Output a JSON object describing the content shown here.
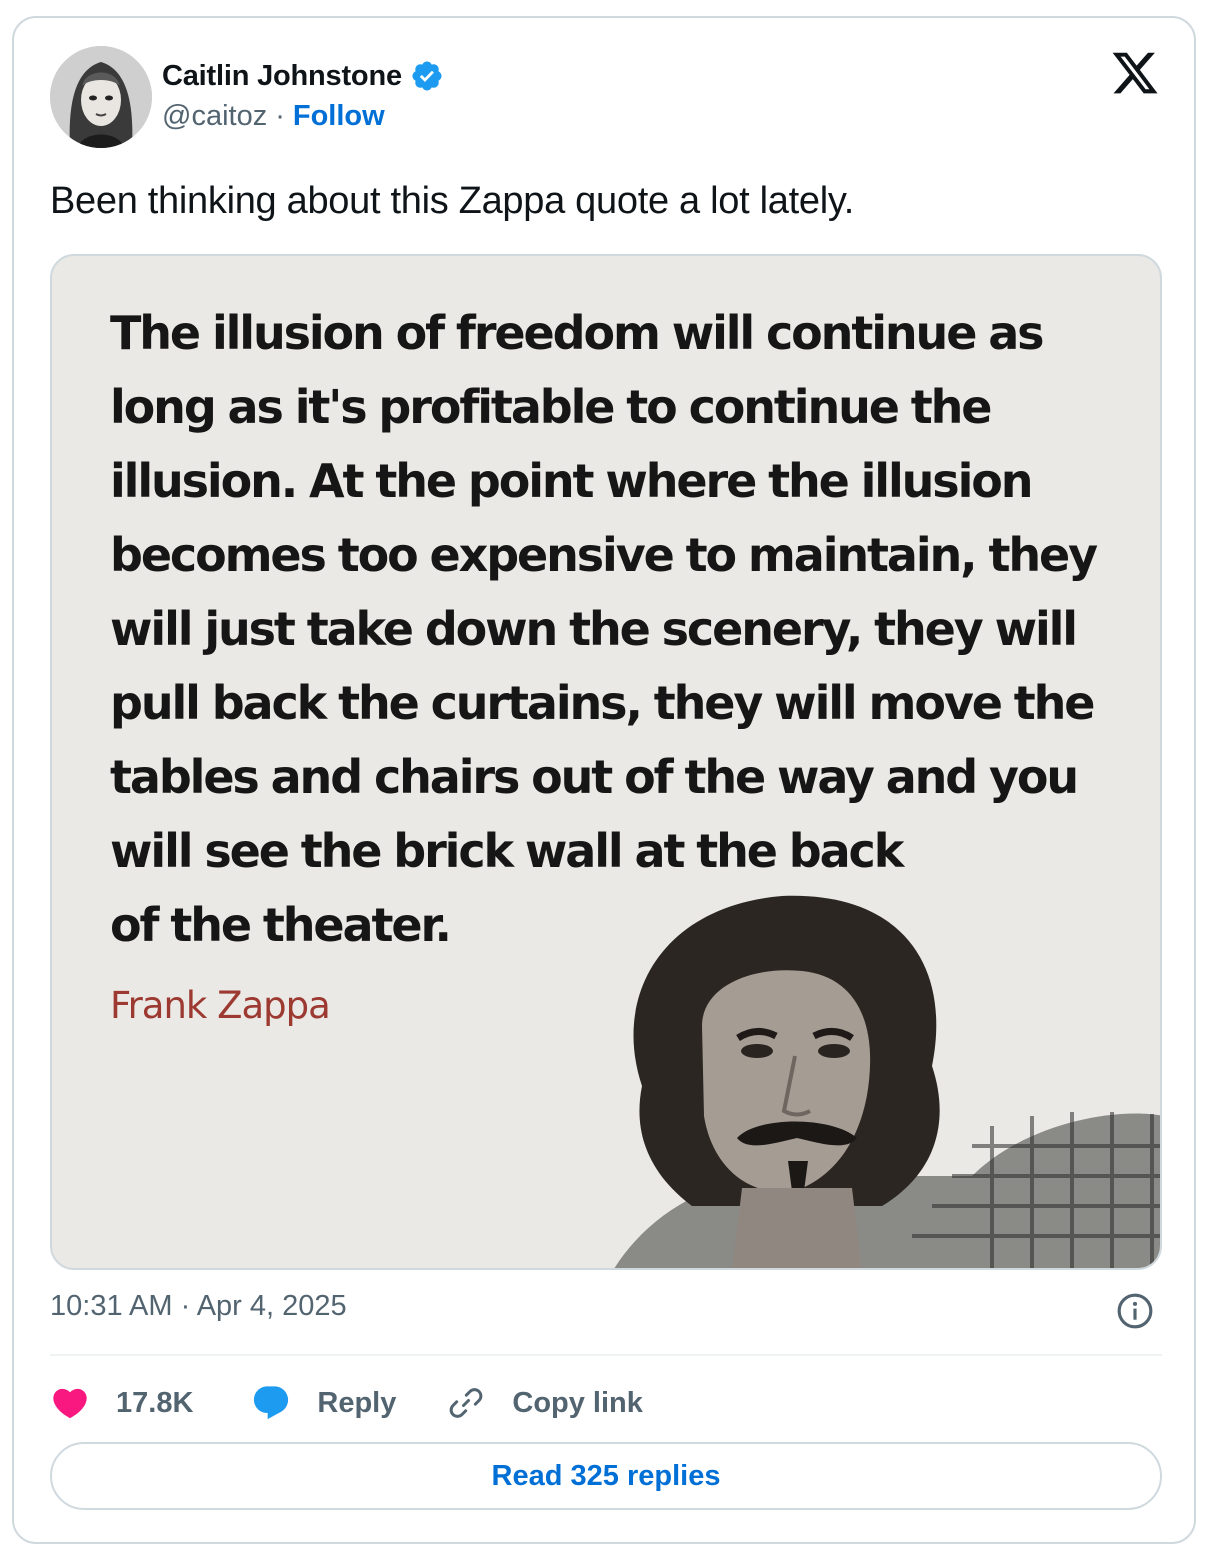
{
  "author": {
    "name": "Caitlin Johnstone",
    "handle": "@caitoz",
    "separator": "·",
    "follow_label": "Follow"
  },
  "tweet": {
    "text": "Been thinking about this Zappa quote a lot lately."
  },
  "media": {
    "quote_lines": [
      "The illusion of freedom will continue as",
      "long as it's profitable to continue the",
      "illusion. At the point where the illusion",
      "becomes too expensive to maintain, they",
      "will just take down the scenery, they will",
      "pull back the curtains, they will move the",
      "tables and chairs out of the way and you",
      "will see the brick wall at the back",
      "of the theater."
    ],
    "attribution": "Frank Zappa"
  },
  "meta": {
    "timestamp": "10:31 AM · Apr 4, 2025"
  },
  "actions": {
    "like_count": "17.8K",
    "reply_label": "Reply",
    "copy_link_label": "Copy link"
  },
  "read_replies_label": "Read 325 replies",
  "colors": {
    "accent": "#006fd6",
    "verified": "#1d9bf0",
    "like": "#f91880",
    "reply": "#1d9bf0",
    "text_primary": "#0f1419",
    "text_secondary": "#536471",
    "border": "#cfd9de",
    "quote_attribution": "#9c3a32"
  },
  "icons": {
    "verified": "verified-badge-icon",
    "x_logo": "x-logo-icon",
    "info": "info-icon",
    "like": "heart-icon",
    "reply": "speech-bubble-icon",
    "copy_link": "link-icon"
  }
}
